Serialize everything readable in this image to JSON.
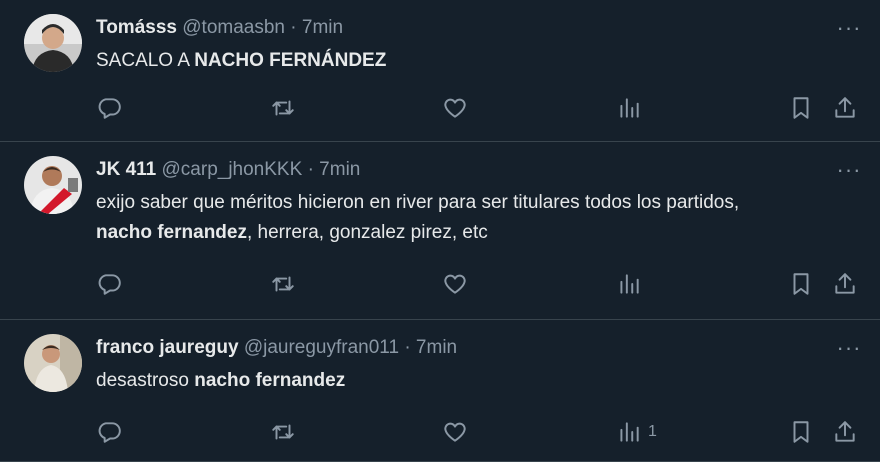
{
  "tweets": [
    {
      "name": "Tomásss",
      "handle": "@tomaasbn",
      "separator": "·",
      "time": "7min",
      "text_before": "SACALO A ",
      "text_bold": "NACHO FERNÁNDEZ",
      "text_after": "",
      "views": ""
    },
    {
      "name": "JK 411",
      "handle": "@carp_jhonKKK",
      "separator": "·",
      "time": "7min",
      "text_before": "exijo saber que méritos hicieron en river para ser titulares todos los partidos, ",
      "text_bold": "nacho fernandez",
      "text_after": ", herrera, gonzalez pirez, etc",
      "views": ""
    },
    {
      "name": "franco jaureguy",
      "handle": "@jaureguyfran011",
      "separator": "·",
      "time": "7min",
      "text_before": "desastroso ",
      "text_bold": "nacho fernandez",
      "text_after": "",
      "views": "1"
    }
  ],
  "more_label": "···",
  "icons": {
    "reply": "reply-icon",
    "retweet": "retweet-icon",
    "like": "like-icon",
    "views": "views-icon",
    "bookmark": "bookmark-icon",
    "share": "share-icon",
    "more": "more-icon"
  },
  "colors": {
    "background": "#15202b",
    "text": "#e7e9ea",
    "muted": "#8b98a5",
    "divider": "#38444d"
  }
}
